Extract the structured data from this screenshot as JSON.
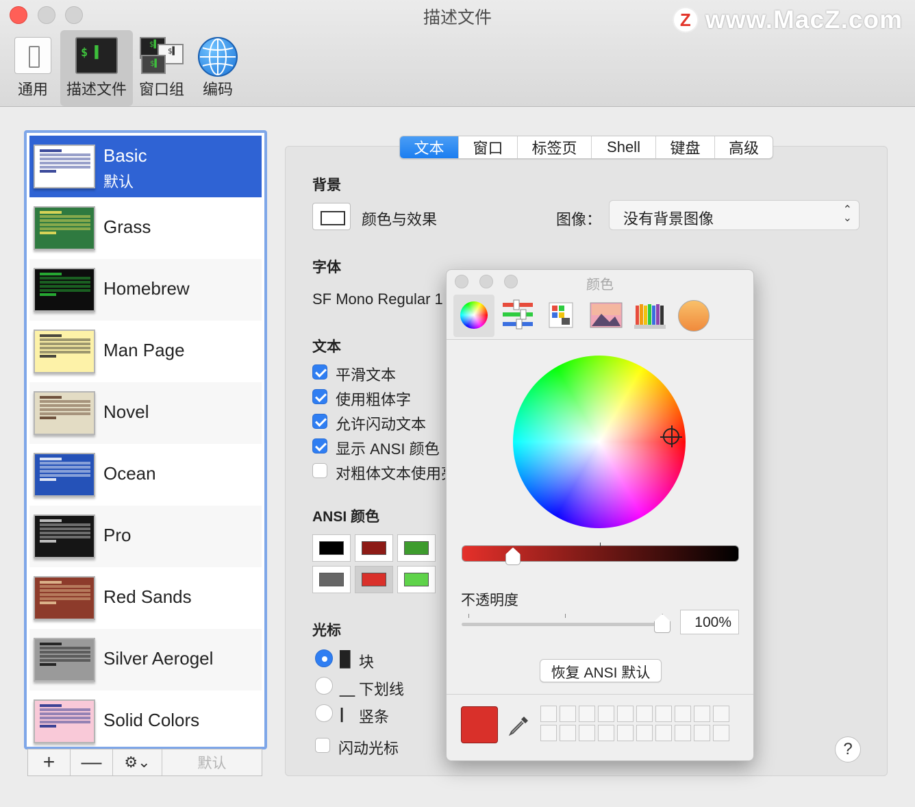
{
  "window": {
    "title": "描述文件",
    "watermark": "www.MacZ.com",
    "watermark_logo": "Z"
  },
  "toolbar": {
    "items": [
      {
        "label": "通用",
        "icon": "switch-icon"
      },
      {
        "label": "描述文件",
        "icon": "terminal-icon"
      },
      {
        "label": "窗口组",
        "icon": "window-group-icon"
      },
      {
        "label": "编码",
        "icon": "globe-icon"
      }
    ],
    "active": "描述文件"
  },
  "profiles": {
    "items": [
      {
        "name": "Basic",
        "subtitle": "默认",
        "thumb_bg": "#ffffff",
        "thumb_fg": "#1b2c8a"
      },
      {
        "name": "Grass",
        "thumb_bg": "#2f7a40",
        "thumb_fg": "#f5e35c"
      },
      {
        "name": "Homebrew",
        "thumb_bg": "#0d0d0d",
        "thumb_fg": "#2bc43a"
      },
      {
        "name": "Man Page",
        "thumb_bg": "#fdf2a8",
        "thumb_fg": "#2a2a2a"
      },
      {
        "name": "Novel",
        "thumb_bg": "#e3dcc4",
        "thumb_fg": "#5a3a26"
      },
      {
        "name": "Ocean",
        "thumb_bg": "#2552b8",
        "thumb_fg": "#ffffff"
      },
      {
        "name": "Pro",
        "thumb_bg": "#151515",
        "thumb_fg": "#d9d9d9"
      },
      {
        "name": "Red Sands",
        "thumb_bg": "#8d3b2b",
        "thumb_fg": "#e8c79a"
      },
      {
        "name": "Silver Aerogel",
        "thumb_bg": "#9a9a9a",
        "thumb_fg": "#111111"
      },
      {
        "name": "Solid Colors",
        "thumb_bg": "#f9c9d8",
        "thumb_fg": "#1b2c8a"
      }
    ],
    "selected": "Basic",
    "footer": {
      "add": "+",
      "remove": "—",
      "gear": "⚙⌄",
      "default": "默认"
    }
  },
  "tabs": {
    "items": [
      "文本",
      "窗口",
      "标签页",
      "Shell",
      "键盘",
      "高级"
    ],
    "active": "文本"
  },
  "settings": {
    "background": {
      "title": "背景",
      "color_effects": "颜色与效果",
      "image_label": "图像：",
      "image_value": "没有背景图像"
    },
    "font": {
      "title": "字体",
      "value": "SF Mono Regular 1"
    },
    "text": {
      "title": "文本",
      "options": [
        {
          "label": "平滑文本",
          "checked": true
        },
        {
          "label": "使用粗体字",
          "checked": true
        },
        {
          "label": "允许闪动文本",
          "checked": true
        },
        {
          "label": "显示 ANSI 颜色",
          "checked": true
        },
        {
          "label": "对粗体文本使用亮",
          "checked": false
        }
      ]
    },
    "ansi": {
      "title": "ANSI 颜色",
      "row1": [
        "#000000",
        "#8d1b16",
        "#3e9c2e"
      ],
      "row2": [
        "#666666",
        "#d9302a",
        "#5fd34a"
      ],
      "selected_index": 4
    },
    "cursor": {
      "title": "光标",
      "options": [
        {
          "glyph": "█",
          "label": "块",
          "checked": true
        },
        {
          "glyph": "＿",
          "label": "下划线",
          "checked": false
        },
        {
          "glyph": "|",
          "label": "竖条",
          "checked": false
        }
      ],
      "blink_label": "闪动光标",
      "blink_checked": false
    },
    "help": "?"
  },
  "color_picker": {
    "title": "颜色",
    "modes": [
      "color-wheel-icon",
      "sliders-icon",
      "palettes-icon",
      "image-palette-icon",
      "pencils-icon",
      "color-sphere-icon"
    ],
    "active_mode": "color-wheel-icon",
    "opacity_label": "不透明度",
    "opacity_value": "100%",
    "opacity_fraction": 1.0,
    "brightness_fraction": 0.19,
    "restore_label": "恢复 ANSI 默认",
    "current_color": "#d9302a",
    "swatch_rows": 2,
    "swatch_cols": 10
  }
}
